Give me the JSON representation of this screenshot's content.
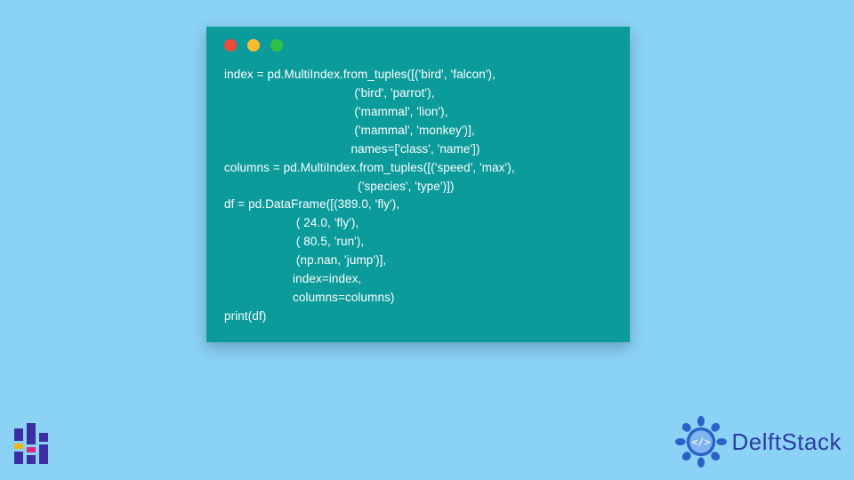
{
  "code": {
    "lines": [
      "index = pd.MultiIndex.from_tuples([('bird', 'falcon'),",
      "                                      ('bird', 'parrot'),",
      "                                      ('mammal', 'lion'),",
      "                                      ('mammal', 'monkey')],",
      "                                     names=['class', 'name'])",
      "columns = pd.MultiIndex.from_tuples([('speed', 'max'),",
      "                                       ('species', 'type')])",
      "df = pd.DataFrame([(389.0, 'fly'),",
      "                     ( 24.0, 'fly'),",
      "                     ( 80.5, 'run'),",
      "                     (np.nan, 'jump')],",
      "                    index=index,",
      "                    columns=columns)",
      "print(df)"
    ]
  },
  "brand": {
    "name": "DelftStack"
  },
  "colors": {
    "page_bg": "#8bd2f7",
    "card_bg": "#0c9b9b",
    "code_fg": "#ffffff",
    "brand_fg": "#2b3d9e"
  }
}
